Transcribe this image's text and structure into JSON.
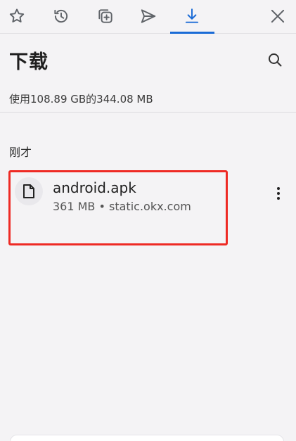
{
  "tabs": [
    {
      "name": "bookmarks",
      "icon": "star-icon"
    },
    {
      "name": "history",
      "icon": "history-icon"
    },
    {
      "name": "tabs",
      "icon": "add-tab-icon"
    },
    {
      "name": "send",
      "icon": "send-icon"
    },
    {
      "name": "downloads",
      "icon": "download-icon",
      "active": true
    },
    {
      "name": "close",
      "icon": "close-icon"
    }
  ],
  "header": {
    "title": "下载"
  },
  "storage": {
    "text": "使用108.89 GB的344.08 MB"
  },
  "section": {
    "label": "刚才"
  },
  "download": {
    "file_name": "android.apk",
    "meta": "361 MB • static.okx.com"
  },
  "colors": {
    "accent": "#1a6bd6",
    "highlight": "#ee2a24",
    "background": "#f4f3f5"
  }
}
